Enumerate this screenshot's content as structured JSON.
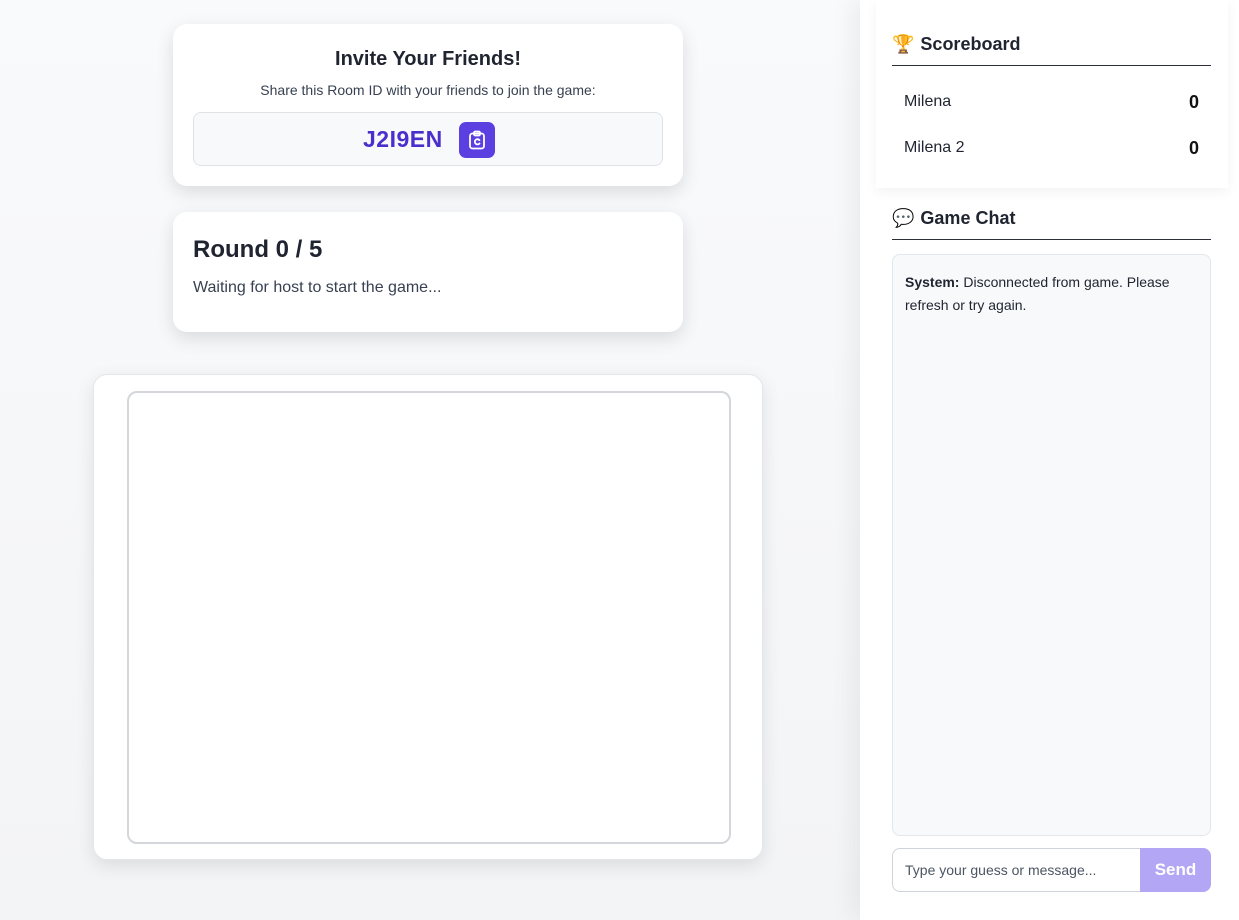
{
  "invite": {
    "title": "Invite Your Friends!",
    "subtitle": "Share this Room ID with your friends to join the game:",
    "room_id": "J2I9EN",
    "copy_icon": "clipboard-icon"
  },
  "round": {
    "title": "Round 0 / 5",
    "status": "Waiting for host to start the game..."
  },
  "scoreboard": {
    "icon": "🏆",
    "title": "Scoreboard",
    "players": [
      {
        "name": "Milena",
        "score": "0"
      },
      {
        "name": "Milena 2",
        "score": "0"
      }
    ]
  },
  "chat": {
    "icon": "💬",
    "title": "Game Chat",
    "messages": [
      {
        "sender": "System:",
        "text": "Disconnected from game. Please refresh or try again."
      }
    ],
    "input_placeholder": "Type your guess or message...",
    "send_label": "Send"
  },
  "colors": {
    "accent": "#5b3fe0",
    "room_id": "#4a2fcc",
    "send_disabled": "#b3a6f5"
  }
}
